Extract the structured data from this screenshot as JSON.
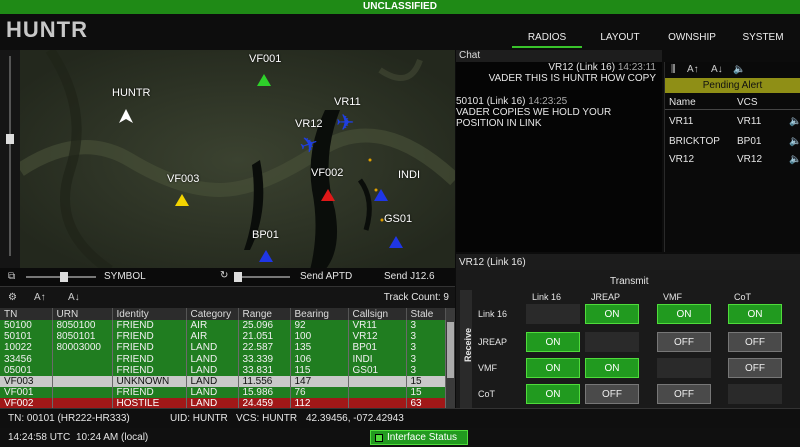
{
  "classification": "UNCLASSIFIED",
  "app_title": "HUNTR",
  "nav_tabs": [
    "RADIOS",
    "LAYOUT",
    "OWNSHIP",
    "SYSTEM"
  ],
  "map": {
    "markers": [
      {
        "label": "VF001",
        "kind": "friend-ground"
      },
      {
        "label": "HUNTR",
        "kind": "ownship"
      },
      {
        "label": "VR11",
        "kind": "friend-air"
      },
      {
        "label": "VR12",
        "kind": "friend-air"
      },
      {
        "label": "VF003",
        "kind": "unknown"
      },
      {
        "label": "VF002",
        "kind": "hostile"
      },
      {
        "label": "INDI",
        "kind": "friend-ground"
      },
      {
        "label": "GS01",
        "kind": "friend-ground"
      },
      {
        "label": "BP01",
        "kind": "friend-ground"
      }
    ]
  },
  "map_controls": {
    "symbol": "SYMBOL",
    "send_aptd": "Send APTD",
    "send_j126": "Send J12.6"
  },
  "chat": {
    "header": "Chat",
    "messages": [
      {
        "sender": "VR12 (Link 16)",
        "time": "14:23:11",
        "text": "VADER THIS IS HUNTR HOW COPY"
      },
      {
        "sender": "50101 (Link 16)",
        "time": "14:23:25",
        "text": "VADER COPIES WE HOLD YOUR POSITION IN LINK"
      }
    ]
  },
  "alerts": {
    "title": "Pending Alert",
    "col_name": "Name",
    "col_vcs": "VCS",
    "rows": [
      {
        "name": "VR11",
        "vcs": "VR11"
      },
      {
        "name": "BRICKTOP",
        "vcs": "BP01"
      },
      {
        "name": "VR12",
        "vcs": "VR12"
      }
    ]
  },
  "tracks": {
    "count_label": "Track Count: 9",
    "columns": [
      "TN",
      "URN",
      "Identity",
      "Category",
      "Range",
      "Bearing",
      "Callsign",
      "Stale"
    ],
    "rows": [
      {
        "cls": "friend",
        "cells": [
          "50100",
          "8050100",
          "FRIEND",
          "AIR",
          "25.096",
          "92",
          "VR11",
          "3"
        ]
      },
      {
        "cls": "friend",
        "cells": [
          "50101",
          "8050101",
          "FRIEND",
          "AIR",
          "21.051",
          "100",
          "VR12",
          "3"
        ]
      },
      {
        "cls": "friend",
        "cells": [
          "10022",
          "80003000",
          "FRIEND",
          "LAND",
          "22.587",
          "135",
          "BP01",
          "3"
        ]
      },
      {
        "cls": "friend",
        "cells": [
          "33456",
          "",
          "FRIEND",
          "LAND",
          "33.339",
          "106",
          "INDI",
          "3"
        ]
      },
      {
        "cls": "friend",
        "cells": [
          "05001",
          "",
          "FRIEND",
          "LAND",
          "33.831",
          "115",
          "GS01",
          "3"
        ]
      },
      {
        "cls": "unknown",
        "cells": [
          "VF003",
          "",
          "UNKNOWN",
          "LAND",
          "11.556",
          "147",
          "",
          "15"
        ]
      },
      {
        "cls": "friend",
        "cells": [
          "VF001",
          "",
          "FRIEND",
          "LAND",
          "15.986",
          "76",
          "",
          "15"
        ]
      },
      {
        "cls": "hostile",
        "cells": [
          "VF002",
          "",
          "HOSTILE",
          "LAND",
          "24.459",
          "112",
          "",
          "63"
        ]
      }
    ]
  },
  "link": {
    "header": "VR12 (Link 16)",
    "transmit": "Transmit",
    "receive": "Receive",
    "cols": [
      "Link 16",
      "JREAP",
      "VMF",
      "CoT"
    ],
    "rows": [
      {
        "label": "Link 16",
        "cells": [
          "",
          "ON",
          "ON",
          "ON"
        ]
      },
      {
        "label": "JREAP",
        "cells": [
          "ON",
          "",
          "OFF",
          "OFF"
        ]
      },
      {
        "label": "VMF",
        "cells": [
          "ON",
          "ON",
          "",
          "OFF"
        ]
      },
      {
        "label": "CoT",
        "cells": [
          "ON",
          "OFF",
          "OFF",
          ""
        ]
      }
    ]
  },
  "status": {
    "tn": "TN: 00101 (HR222-HR333)",
    "uid": "UID: HUNTR",
    "vcs": "VCS: HUNTR",
    "coords": "42.39456, -072.42943"
  },
  "footer": {
    "utc": "14:24:58 UTC",
    "local": "10:24 AM (local)",
    "interface": "Interface Status"
  }
}
